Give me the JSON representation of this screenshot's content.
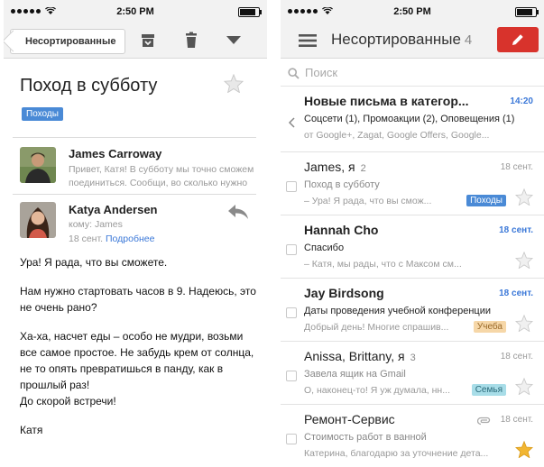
{
  "status": {
    "time": "2:50 PM"
  },
  "left": {
    "back_label": "Несортированные",
    "subject": "Поход в субботу",
    "label": "Походы",
    "messages": [
      {
        "sender": "James Carroway",
        "snippet_line1": "Привет, Катя! В субботу мы точно сможем",
        "snippet_line2": "поединиться. Сообщи, во сколько нужно"
      },
      {
        "sender": "Katya Andersen",
        "to": "кому: James",
        "date": "18 сент.",
        "more": "Подробнее"
      }
    ],
    "body": [
      "Ура! Я рада, что вы сможете.",
      "Нам нужно стартовать часов в 9. Надеюсь, это не очень рано?",
      "Ха-ха, насчет еды – особо не мудри, возьми все самое простое. Не забудь крем от солнца, не то опять превратишься в панду, как в прошлый раз!\nДо скорой встречи!",
      "Катя"
    ]
  },
  "right": {
    "title": "Несортированные",
    "count": "4",
    "search_placeholder": "Поиск",
    "rows": [
      {
        "from": "Новые письма в категор...",
        "time": "14:20",
        "line1": "Соцсети (1), Промоакции (2), Оповещения (1)",
        "line2": "от Google+, Zagat, Google Offers, Google..."
      },
      {
        "from": "James, я",
        "count": "2",
        "date": "18 сент.",
        "subject": "Поход в субботу",
        "snippet": "– Ура! Я рада, что вы смож...",
        "tag": "Походы"
      },
      {
        "from": "Hannah Cho",
        "date": "18 сент.",
        "subject": "Спасибо",
        "snippet": "– Катя, мы рады, что с Максом см..."
      },
      {
        "from": "Jay Birdsong",
        "date": "18 сент.",
        "subject": "Даты проведения учебной конференции",
        "snippet": "Добрый день! Многие спрашив...",
        "tag": "Учеба"
      },
      {
        "from": "Anissa, Brittany, я",
        "count": "3",
        "date": "18 сент.",
        "subject": "Завела ящик на Gmail",
        "snippet": "О, наконец-то! Я уж думала, нн...",
        "tag": "Семья"
      },
      {
        "from": "Ремонт-Сервис",
        "date": "18 сент.",
        "subject": "Стоимость работ в ванной",
        "snippet": "Катерина, благодарю за уточнение дета..."
      }
    ]
  },
  "colors": {
    "accent": "#d8332c",
    "link": "#3b78d8",
    "tag_blue": "#4a8ad6",
    "tag_study": "#f6d7a8",
    "tag_family": "#a8dde8",
    "star_gold": "#f2b632"
  }
}
